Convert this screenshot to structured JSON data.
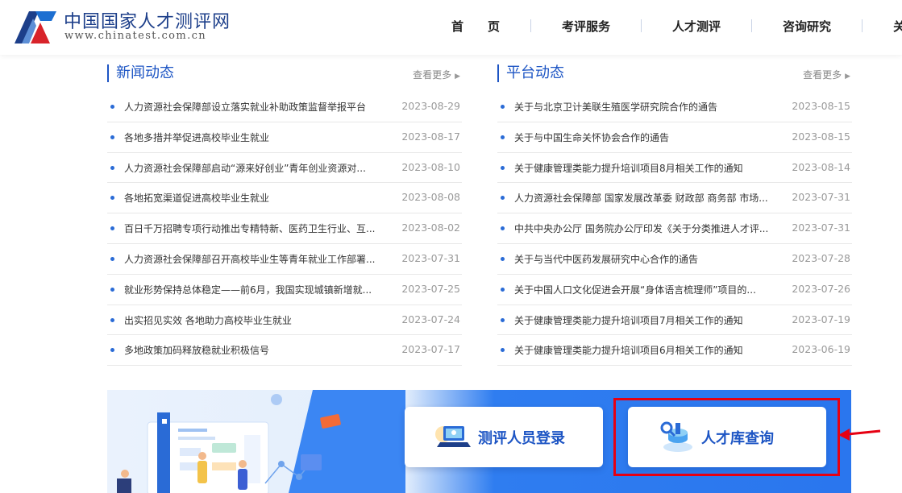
{
  "header": {
    "title": "中国国家人才测评网",
    "url": "www.chinatest.com.cn",
    "nav": [
      "首　　页",
      "考评服务",
      "人才测评",
      "咨询研究",
      "关于我们"
    ]
  },
  "news": {
    "title": "新闻动态",
    "more": "查看更多",
    "items": [
      {
        "title": "人力资源社会保障部设立落实就业补助政策监督举报平台",
        "date": "2023-08-29"
      },
      {
        "title": "各地多措并举促进高校毕业生就业",
        "date": "2023-08-17"
      },
      {
        "title": "人力资源社会保障部启动“源来好创业”青年创业资源对...",
        "date": "2023-08-10"
      },
      {
        "title": "各地拓宽渠道促进高校毕业生就业",
        "date": "2023-08-08"
      },
      {
        "title": "百日千万招聘专项行动推出专精特新、医药卫生行业、互...",
        "date": "2023-08-02"
      },
      {
        "title": "人力资源社会保障部召开高校毕业生等青年就业工作部署...",
        "date": "2023-07-31"
      },
      {
        "title": "就业形势保持总体稳定——前6月，我国实现城镇新增就...",
        "date": "2023-07-25"
      },
      {
        "title": "出实招见实效 各地助力高校毕业生就业",
        "date": "2023-07-24"
      },
      {
        "title": "多地政策加码释放稳就业积极信号",
        "date": "2023-07-17"
      }
    ]
  },
  "platform": {
    "title": "平台动态",
    "more": "查看更多",
    "items": [
      {
        "title": "关于与北京卫计美联生殖医学研究院合作的通告",
        "date": "2023-08-15"
      },
      {
        "title": "关于与中国生命关怀协会合作的通告",
        "date": "2023-08-15"
      },
      {
        "title": "关于健康管理类能力提升培训项目8月相关工作的通知",
        "date": "2023-08-14"
      },
      {
        "title": "人力资源社会保障部 国家发展改革委 财政部 商务部 市场...",
        "date": "2023-07-31"
      },
      {
        "title": "中共中央办公厅 国务院办公厅印发《关于分类推进人才评...",
        "date": "2023-07-31"
      },
      {
        "title": "关于与当代中医药发展研究中心合作的通告",
        "date": "2023-07-28"
      },
      {
        "title": "关于中国人口文化促进会开展“身体语言梳理师”项目的...",
        "date": "2023-07-26"
      },
      {
        "title": "关于健康管理类能力提升培训项目7月相关工作的通知",
        "date": "2023-07-19"
      },
      {
        "title": "关于健康管理类能力提升培训项目6月相关工作的通知",
        "date": "2023-06-19"
      }
    ]
  },
  "banner": {
    "login_label": "测评人员登录",
    "talent_label": "人才库查询"
  },
  "colors": {
    "brand_blue": "#1d55c4",
    "highlight_red": "#e60012"
  }
}
